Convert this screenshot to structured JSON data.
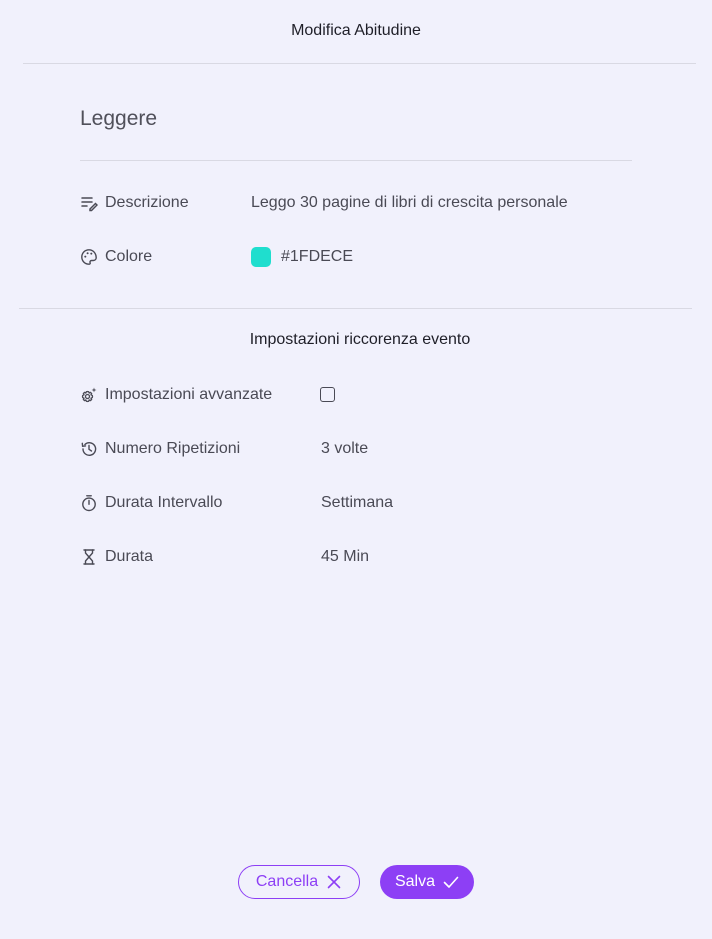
{
  "dialog": {
    "title": "Modifica Abitudine"
  },
  "habit": {
    "name": "Leggere",
    "description_label": "Descrizione",
    "description_value": "Leggo 30 pagine di libri di crescita personale",
    "color_label": "Colore",
    "color_value": "#1FDECE"
  },
  "recurrence": {
    "section_title": "Impostazioni riccorenza evento",
    "advanced_label": "Impostazioni avvanzate",
    "advanced_checked": false,
    "repetitions_label": "Numero Ripetizioni",
    "repetitions_value": "3 volte",
    "interval_label": "Durata Intervallo",
    "interval_value": "Settimana",
    "duration_label": "Durata",
    "duration_value": "45 Min"
  },
  "footer": {
    "cancel_label": "Cancella",
    "save_label": "Salva"
  },
  "colors": {
    "accent": "#8d3ff5",
    "background": "#f1f1fc",
    "swatch": "#1FDECE"
  },
  "icons": {
    "description": "edit-notes-icon",
    "color": "palette-icon",
    "advanced": "settings-sparkle-icon",
    "repetitions": "history-icon",
    "interval": "timer-icon",
    "duration": "hourglass-icon",
    "cancel": "close-icon",
    "save": "check-icon"
  }
}
